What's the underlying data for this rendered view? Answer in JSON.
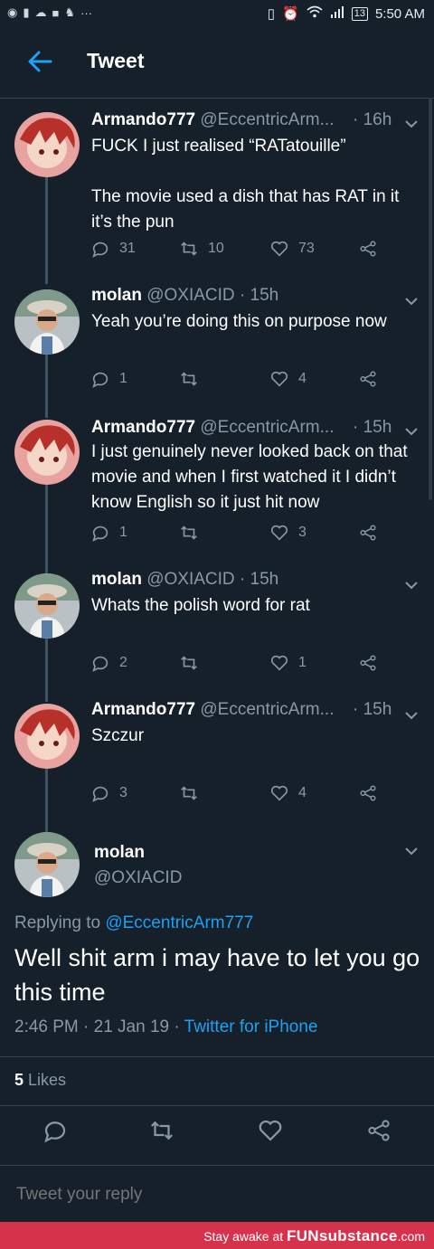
{
  "status_bar": {
    "battery": "13",
    "time": "5:50 AM",
    "more": "···"
  },
  "header": {
    "title": "Tweet"
  },
  "colors": {
    "background": "#15202b",
    "accent": "#1da1f2",
    "muted": "#8899a6",
    "divider": "#38444d"
  },
  "tweets": [
    {
      "name": "Armando777",
      "handle": "@EccentricArm...",
      "time": "· 16h",
      "text": "FUCK I just realised “RATatouille”\n\nThe movie used a dish that has RAT in it it’s the pun",
      "replies": "31",
      "retweets": "10",
      "likes": "73",
      "avatar": "anime-avatar"
    },
    {
      "name": "molan",
      "handle": "@OXIACID",
      "time": "· 15h",
      "text": "Yeah you’re doing this on purpose now",
      "replies": "1",
      "retweets": "",
      "likes": "4",
      "avatar": "photo-avatar"
    },
    {
      "name": "Armando777",
      "handle": "@EccentricArm...",
      "time": "· 15h",
      "text": "I just genuinely never looked back on that movie and when I first watched it I didn’t know English so it just hit now",
      "replies": "1",
      "retweets": "",
      "likes": "3",
      "avatar": "anime-avatar"
    },
    {
      "name": "molan",
      "handle": "@OXIACID",
      "time": "· 15h",
      "text": "Whats the polish word for rat",
      "replies": "2",
      "retweets": "",
      "likes": "1",
      "avatar": "photo-avatar"
    },
    {
      "name": "Armando777",
      "handle": "@EccentricArm...",
      "time": "· 15h",
      "text": "Szczur",
      "replies": "3",
      "retweets": "",
      "likes": "4",
      "avatar": "anime-avatar"
    }
  ],
  "main_tweet": {
    "name": "molan",
    "handle": "@OXIACID",
    "replying_prefix": "Replying to",
    "replying_to": "@EccentricArm777",
    "text": "Well shit arm i may have to let you go this time",
    "time": "2:46 PM · 21 Jan 19 ·",
    "source": "Twitter for iPhone",
    "likes_count": "5",
    "likes_label": "Likes"
  },
  "reply_box": {
    "placeholder": "Tweet your reply"
  },
  "watermark": {
    "prefix": "Stay awake at",
    "brand": "FUNsubstance",
    "suffix": ".com"
  }
}
